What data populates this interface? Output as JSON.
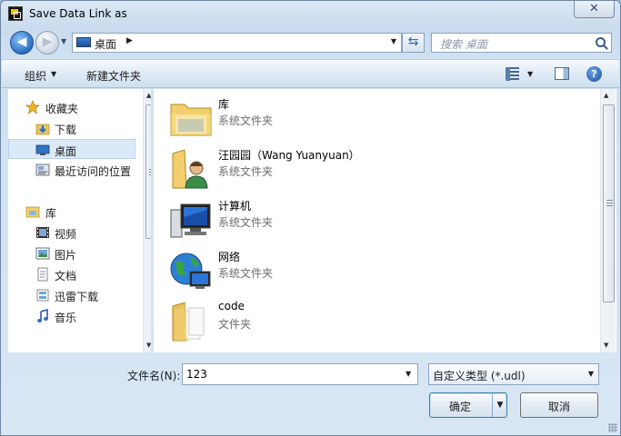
{
  "window": {
    "title": "Save Data Link as",
    "close_label": "✕"
  },
  "address": {
    "location": "桌面",
    "separator": "▶",
    "search_placeholder": "搜索 桌面"
  },
  "toolbar": {
    "organize_label": "组织",
    "new_folder_label": "新建文件夹",
    "help_label": "?"
  },
  "nav": {
    "items": [
      {
        "label": "收藏夹",
        "icon": "star-icon"
      },
      {
        "label": "下载",
        "icon": "download-folder-icon"
      },
      {
        "label": "桌面",
        "icon": "desktop-icon",
        "selected": true
      },
      {
        "label": "最近访问的位置",
        "icon": "recent-places-icon"
      },
      {
        "label": "库",
        "icon": "library-icon"
      },
      {
        "label": "视频",
        "icon": "video-icon"
      },
      {
        "label": "图片",
        "icon": "pictures-icon"
      },
      {
        "label": "文档",
        "icon": "documents-icon"
      },
      {
        "label": "迅雷下载",
        "icon": "xunlei-download-icon"
      },
      {
        "label": "音乐",
        "icon": "music-icon"
      }
    ]
  },
  "files": [
    {
      "name": "库",
      "type": "系统文件夹",
      "icon": "library-folder-icon"
    },
    {
      "name": "汪园园（Wang Yuanyuan）",
      "type": "系统文件夹",
      "icon": "user-folder-icon"
    },
    {
      "name": "计算机",
      "type": "系统文件夹",
      "icon": "computer-icon"
    },
    {
      "name": "网络",
      "type": "系统文件夹",
      "icon": "network-icon"
    },
    {
      "name": "code",
      "type": "文件夹",
      "icon": "folder-icon"
    }
  ],
  "footer": {
    "filename_label": "文件名(N):",
    "filename_value": "123",
    "filetype_value": "自定义类型 (*.udl)",
    "save_label": "确定",
    "cancel_label": "取消"
  },
  "colors": {
    "accent": "#3c7fb1",
    "selection": "#dbe9f8"
  }
}
